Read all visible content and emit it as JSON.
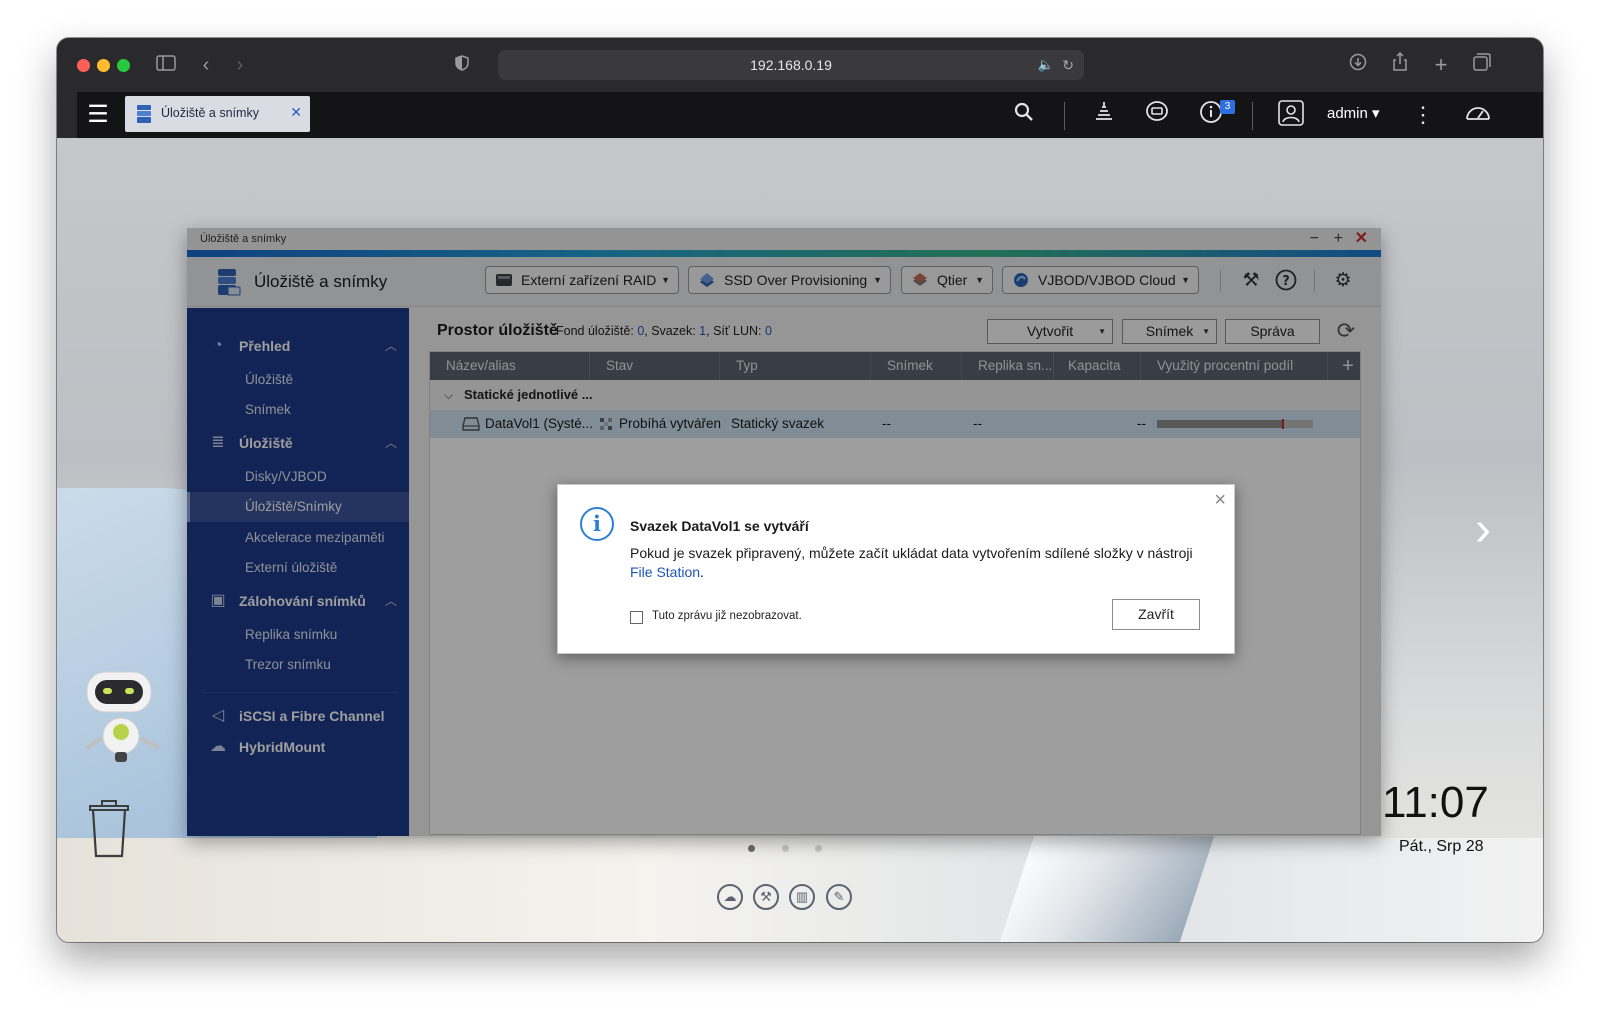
{
  "browser": {
    "url": "192.168.0.19"
  },
  "qts": {
    "tab_label": "Úložiště a snímky",
    "notification_count": "3",
    "user": "admin ▾"
  },
  "desktop": {
    "time": "11:07",
    "date": "Pát., Srp 28"
  },
  "app": {
    "window_title": "Úložiště a snímky",
    "title": "Úložiště a snímky",
    "toolbar": [
      {
        "label": "Externí zařízení RAID"
      },
      {
        "label": "SSD Over Provisioning"
      },
      {
        "label": "Qtier"
      },
      {
        "label": "VJBOD/VJBOD Cloud"
      }
    ]
  },
  "sidebar": {
    "groups": [
      {
        "label": "Přehled",
        "items": [
          "Úložiště",
          "Snímek"
        ]
      },
      {
        "label": "Úložiště",
        "items": [
          "Disky/VJBOD",
          "Úložiště/Snímky",
          "Akcelerace mezipaměti",
          "Externí úložiště"
        ]
      },
      {
        "label": "Zálohování snímků",
        "items": [
          "Replika snímku",
          "Trezor snímku"
        ]
      }
    ],
    "extra": [
      "iSCSI a Fibre Channel",
      "HybridMount"
    ],
    "active_item": "Úložiště/Snímky"
  },
  "main": {
    "title": "Prostor úložiště",
    "stats": {
      "pool_label": "Fond úložiště:",
      "pool_value": "0",
      "volume_label": "Svazek:",
      "volume_value": "1",
      "lun_label": "Síť LUN:",
      "lun_value": "0"
    },
    "buttons": {
      "create": "Vytvořit",
      "snapshot": "Snímek",
      "manage": "Správa"
    },
    "columns": [
      "Název/alias",
      "Stav",
      "Typ",
      "Snímek",
      "Replika sn...",
      "Kapacita",
      "Využitý procentní podíl"
    ],
    "group_row": "Statické jednotlivé ...",
    "row": {
      "name": "DataVol1 (Systé...",
      "status": "Probíhá vytváření",
      "type": "Statický svazek",
      "snapshot": "--",
      "replica": "--",
      "capacity": "--",
      "usage_fraction": 0.8
    }
  },
  "dialog": {
    "title": "Svazek DataVol1 se vytváří",
    "message": "Pokud je svazek připravený, můžete začít ukládat data vytvořením sdílené složky v nástroji",
    "link": "File Station",
    "link_suffix": ".",
    "checkbox_label": "Tuto zprávu již nezobrazovat.",
    "button": "Zavřít"
  },
  "colors": {
    "sidebar": "#1d3a8a",
    "accent": "#2d7fd6",
    "close_red": "#d32f2f"
  }
}
